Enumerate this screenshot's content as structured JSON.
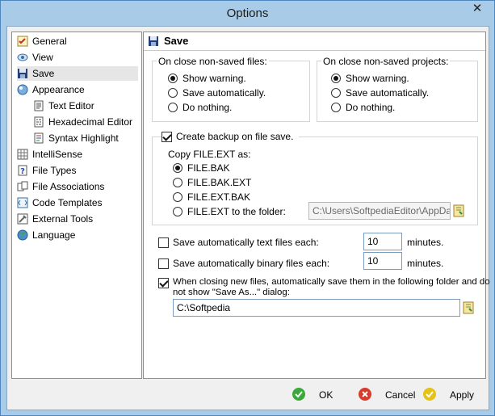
{
  "window": {
    "title": "Options",
    "close_glyph": "✕"
  },
  "tree": {
    "items": [
      {
        "label": "General",
        "icon": "checklist-icon"
      },
      {
        "label": "View",
        "icon": "view-icon"
      },
      {
        "label": "Save",
        "icon": "floppy-disk-icon"
      },
      {
        "label": "Appearance",
        "icon": "appearance-icon"
      },
      {
        "label": "Text Editor",
        "icon": "document-icon"
      },
      {
        "label": "Hexadecimal Editor",
        "icon": "hex-document-icon"
      },
      {
        "label": "Syntax Highlight",
        "icon": "syntax-document-icon"
      },
      {
        "label": "IntelliSense",
        "icon": "grid-icon"
      },
      {
        "label": "File Types",
        "icon": "help-document-icon"
      },
      {
        "label": "File Associations",
        "icon": "associations-icon"
      },
      {
        "label": "Code Templates",
        "icon": "template-icon"
      },
      {
        "label": "External Tools",
        "icon": "tools-icon"
      },
      {
        "label": "Language",
        "icon": "globe-icon"
      }
    ]
  },
  "panel": {
    "title": "Save",
    "non_saved_files": {
      "caption": "On close non-saved files:",
      "options": [
        "Show warning.",
        "Save automatically.",
        "Do nothing."
      ],
      "selected": 0
    },
    "non_saved_projects": {
      "caption": "On close non-saved projects:",
      "options": [
        "Show warning.",
        "Save automatically.",
        "Do nothing."
      ],
      "selected": 0
    },
    "backup": {
      "checkbox_label": "Create backup on file save.",
      "checked": true,
      "copy_label": "Copy FILE.EXT as:",
      "options": [
        "FILE.BAK",
        "FILE.BAK.EXT",
        "FILE.EXT.BAK",
        "FILE.EXT to the folder:"
      ],
      "selected": 0,
      "folder_value": "C:\\Users\\SoftpediaEditor\\AppData\\"
    },
    "autosave_text": {
      "label": "Save automatically text files each:",
      "checked": false,
      "value": "10",
      "unit": "minutes."
    },
    "autosave_binary": {
      "label": "Save automatically binary files each:",
      "checked": false,
      "value": "10",
      "unit": "minutes."
    },
    "new_files": {
      "label_line1": "When closing new files, automatically save them in the following folder and do",
      "label_line2": "not show \"Save As...\" dialog:",
      "checked": true,
      "folder_value": "C:\\Softpedia"
    }
  },
  "buttons": {
    "ok": "OK",
    "cancel": "Cancel",
    "apply": "Apply"
  },
  "colors": {
    "ok_green": "#3aa83a",
    "cancel_red": "#d83b2b",
    "apply_yellow": "#e4c21a"
  }
}
